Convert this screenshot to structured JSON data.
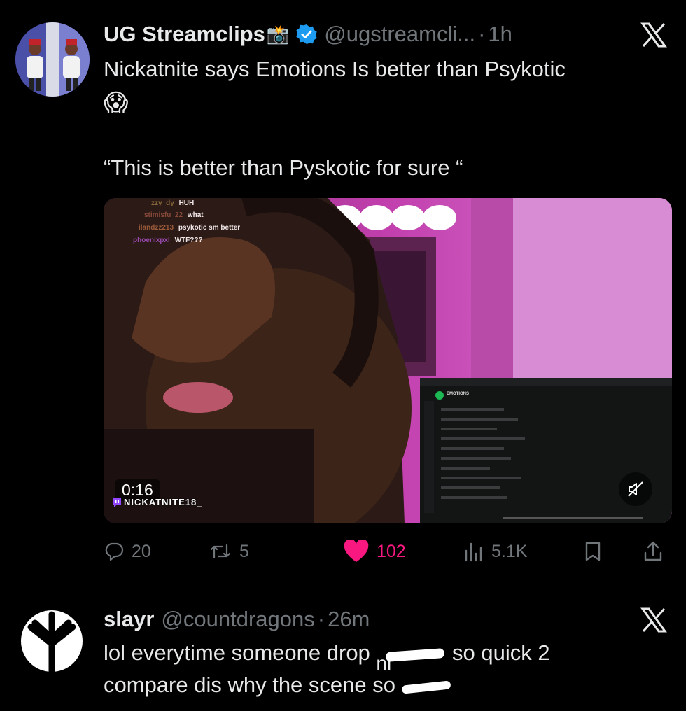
{
  "tweet1": {
    "display_name": "UG Streamclips",
    "name_emoji": "📸",
    "handle": "@ugstreamcli...",
    "separator": "·",
    "time": "1h",
    "text_line1": "Nickatnite says Emotions Is better than Psykotic",
    "text_emoji": "😱",
    "quote": "“This is better than Pyskotic for sure “",
    "video": {
      "duration": "0:16",
      "streamer": "NICKATNITE18_",
      "chat": [
        {
          "user": "zzy_dy",
          "msg": "HUH"
        },
        {
          "user": "stimisfu_22",
          "msg": "what"
        },
        {
          "user": "ilandzz213",
          "msg": "psykotic sm better"
        },
        {
          "user": "phoenixpxl",
          "msg": "WTF???"
        }
      ],
      "playlist_title": "EMOTIONS"
    },
    "actions": {
      "replies": "20",
      "reposts": "5",
      "likes": "102",
      "views": "5.1K"
    },
    "colors": {
      "like": "#f91880",
      "verified": "#1d9bf0"
    }
  },
  "tweet2": {
    "display_name": "slayr",
    "handle": "@countdragons",
    "separator": "·",
    "time": "26m",
    "line1_pre": "lol everytime someone drop ",
    "line1_post": " so quick 2",
    "line2": "compare dis why the scene so "
  }
}
